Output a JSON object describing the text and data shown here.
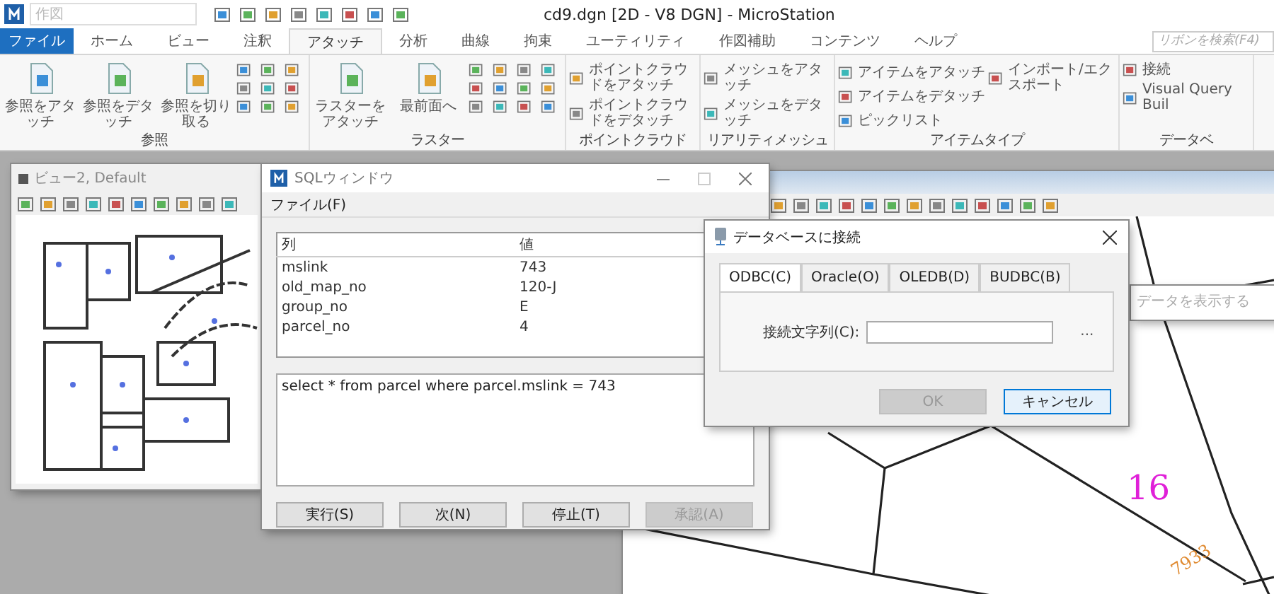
{
  "app": {
    "title": "cd9.dgn [2D - V8 DGN] - MicroStation",
    "quick_access": {
      "placeholder": "作図"
    }
  },
  "ribbon_tabs": [
    {
      "label": "ファイル",
      "kind": "file",
      "selected": false
    },
    {
      "label": "ホーム",
      "kind": "tab",
      "selected": false
    },
    {
      "label": "ビュー",
      "kind": "tab",
      "selected": false
    },
    {
      "label": "注釈",
      "kind": "tab",
      "selected": false
    },
    {
      "label": "アタッチ",
      "kind": "tab",
      "selected": true
    },
    {
      "label": "分析",
      "kind": "tab",
      "selected": false
    },
    {
      "label": "曲線",
      "kind": "tab",
      "selected": false
    },
    {
      "label": "拘束",
      "kind": "tab",
      "selected": false
    },
    {
      "label": "ユーティリティ",
      "kind": "tab",
      "selected": false
    },
    {
      "label": "作図補助",
      "kind": "tab",
      "selected": false
    },
    {
      "label": "コンテンツ",
      "kind": "tab",
      "selected": false
    },
    {
      "label": "ヘルプ",
      "kind": "tab",
      "selected": false
    }
  ],
  "ribbon_search": {
    "placeholder": "リボンを検索(F4)"
  },
  "ribbon_groups": [
    {
      "label": "参照",
      "kind": "large",
      "buttons": [
        "参照をアタッチ",
        "参照をデタッチ",
        "参照を切り取る"
      ]
    },
    {
      "label": "ラスター",
      "kind": "large",
      "buttons": [
        "ラスターをアタッチ",
        "最前面へ"
      ]
    },
    {
      "label": "ポイントクラウド",
      "kind": "list",
      "columns": [
        [
          "ポイントクラウドをアタッチ",
          "ポイントクラウドをデタッチ"
        ]
      ]
    },
    {
      "label": "リアリティメッシュ",
      "kind": "list",
      "columns": [
        [
          "メッシュをアタッチ",
          "メッシュをデタッチ"
        ]
      ]
    },
    {
      "label": "アイテムタイプ",
      "kind": "list",
      "columns": [
        [
          "アイテムをアタッチ",
          "アイテムをデタッチ",
          "ピックリスト"
        ],
        [
          "インポート/エクスポート"
        ]
      ]
    },
    {
      "label": "データベ",
      "kind": "list",
      "columns": [
        [
          "接続",
          "Visual Query Buil"
        ]
      ]
    }
  ],
  "view_window": {
    "title": "ビュー2, Default"
  },
  "map_labels": [
    {
      "text": "16",
      "color": "#e020d8"
    },
    {
      "text": "7933",
      "color": "#e08a30"
    }
  ],
  "hidden_window": {
    "title": "データを表示する"
  },
  "sql_window": {
    "title": "SQLウィンドウ",
    "menu": [
      "ファイル(F)"
    ],
    "table": {
      "columns": [
        "列",
        "値"
      ],
      "rows": [
        [
          "mslink",
          "743"
        ],
        [
          "old_map_no",
          "120-J"
        ],
        [
          "group_no",
          "E"
        ],
        [
          "parcel_no",
          "4"
        ]
      ]
    },
    "query": "select * from parcel where parcel.mslink = 743",
    "buttons": [
      {
        "label": "実行(S)",
        "disabled": false
      },
      {
        "label": "次(N)",
        "disabled": false
      },
      {
        "label": "停止(T)",
        "disabled": false
      },
      {
        "label": "承認(A)",
        "disabled": true
      }
    ]
  },
  "db_dialog": {
    "title": "データベースに接続",
    "tabs": [
      {
        "label": "ODBC(C)",
        "selected": true
      },
      {
        "label": "Oracle(O)",
        "selected": false
      },
      {
        "label": "OLEDB(D)",
        "selected": false
      },
      {
        "label": "BUDBC(B)",
        "selected": false
      }
    ],
    "field_label": "接続文字列(C):",
    "browse": "...",
    "buttons": [
      {
        "label": "OK",
        "disabled": true,
        "default": false
      },
      {
        "label": "キャンセル",
        "disabled": false,
        "default": true
      }
    ]
  }
}
